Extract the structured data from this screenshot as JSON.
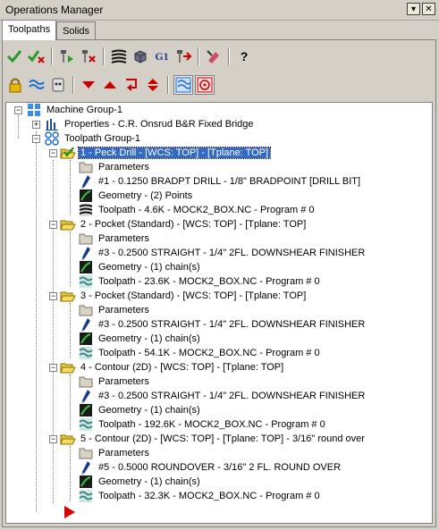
{
  "window": {
    "title": "Operations Manager",
    "min_label": "▾",
    "close_label": "✕"
  },
  "tabs": [
    {
      "label": "Toolpaths"
    },
    {
      "label": "Solids"
    }
  ],
  "toolbar1": {
    "g1_label": "G1",
    "help_label": "?"
  },
  "colors": {
    "selection": "#316ac5",
    "tree_bg": "#ffffff",
    "chrome": "#d4d0c8",
    "red": "#cc0000",
    "blue": "#1f6fd0"
  },
  "tree": {
    "machine_group": "Machine Group-1",
    "properties": "Properties - C.R. Onsrud B&R Fixed Bridge",
    "toolpath_group": "Toolpath Group-1",
    "operations": [
      {
        "label": "1 - Peck Drill - [WCS: TOP] - [Tplane: TOP]",
        "parameters": "Parameters",
        "tool": "#1 - 0.1250 BRADPT DRILL - 1/8\" BRADPOINT [DRILL BIT]",
        "geometry": "Geometry - (2) Points",
        "toolpath": "Toolpath - 4.6K - MOCK2_BOX.NC - Program # 0"
      },
      {
        "label": "2 - Pocket (Standard) - [WCS: TOP] - [Tplane: TOP]",
        "parameters": "Parameters",
        "tool": "#3 - 0.2500 STRAIGHT - 1/4\" 2FL. DOWNSHEAR FINISHER",
        "geometry": "Geometry - (1) chain(s)",
        "toolpath": "Toolpath - 23.6K - MOCK2_BOX.NC - Program # 0"
      },
      {
        "label": "3 - Pocket (Standard) - [WCS: TOP] - [Tplane: TOP]",
        "parameters": "Parameters",
        "tool": "#3 - 0.2500 STRAIGHT - 1/4\" 2FL. DOWNSHEAR FINISHER",
        "geometry": "Geometry - (1) chain(s)",
        "toolpath": "Toolpath - 54.1K - MOCK2_BOX.NC - Program # 0"
      },
      {
        "label": "4 - Contour (2D) - [WCS: TOP] - [Tplane: TOP]",
        "parameters": "Parameters",
        "tool": "#3 - 0.2500 STRAIGHT - 1/4\" 2FL. DOWNSHEAR FINISHER",
        "geometry": "Geometry - (1) chain(s)",
        "toolpath": "Toolpath - 192.6K - MOCK2_BOX.NC - Program # 0"
      },
      {
        "label": "5 - Contour (2D) - [WCS: TOP] - [Tplane: TOP] - 3/16\" round over",
        "parameters": "Parameters",
        "tool": "#5 - 0.5000 ROUNDOVER - 3/16\" 2 FL. ROUND OVER",
        "geometry": "Geometry - (1) chain(s)",
        "toolpath": "Toolpath - 32.3K - MOCK2_BOX.NC - Program # 0"
      }
    ]
  }
}
